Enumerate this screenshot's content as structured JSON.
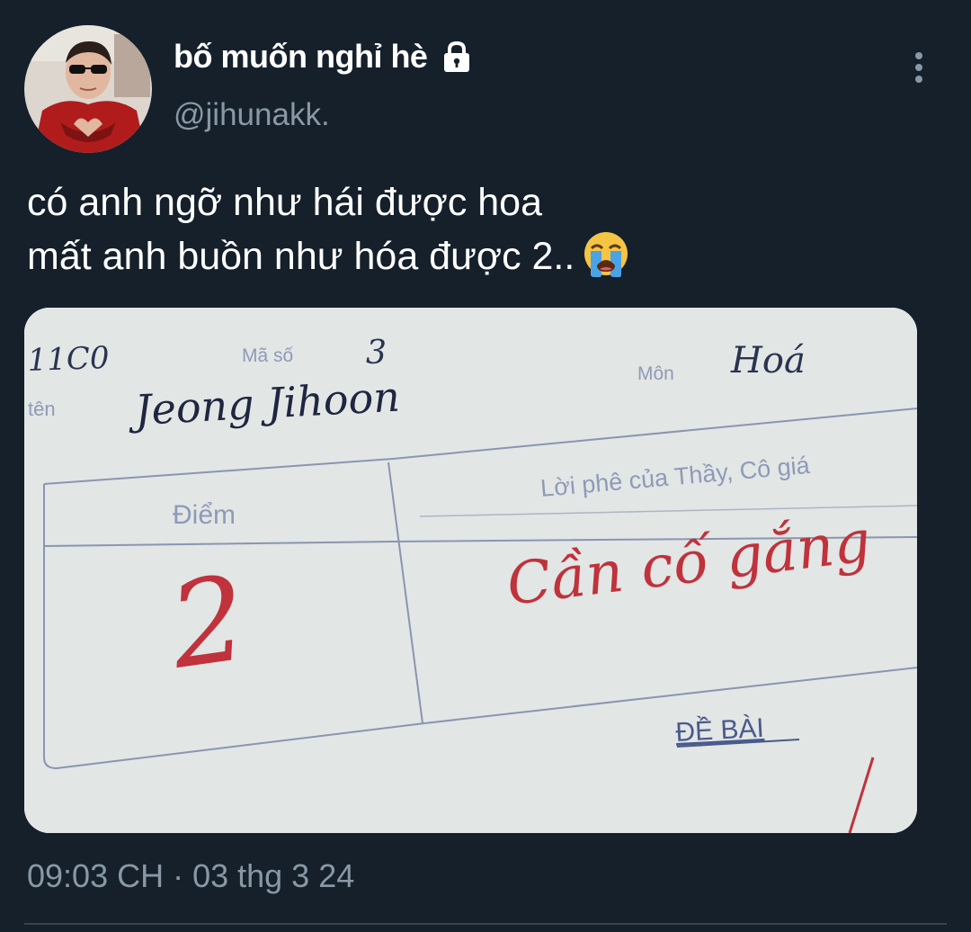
{
  "user": {
    "display_name": "bố muốn nghỉ hè",
    "handle": "@jihunakk.",
    "lock_icon": "lock-icon",
    "avatar_icon": "avatar"
  },
  "menu": {
    "more_icon": "more-vertical-icon"
  },
  "tweet": {
    "text_line_1": "có anh ngỡ như hái được hoa",
    "text_line_2": "mất anh buồn như hóa được 2..",
    "emoji": "loudly-crying-face-emoji"
  },
  "media": {
    "class_label": "11C0",
    "ma_so_label": "Mã số",
    "ma_so_value": "3",
    "mon_label": "Môn",
    "mon_value": "Hoá",
    "ten_label": "tên",
    "name_value": "Jeong Jihoon",
    "diem_label": "Điểm",
    "score_value": "2",
    "comment_label": "Lời phê của Thầy, Cô giá",
    "comment_value": "Cần cố gắng",
    "de_bai_label": "ĐỀ BÀI"
  },
  "meta": {
    "timestamp": "09:03 CH · 03 thg 3 24"
  },
  "colors": {
    "background": "#15202b",
    "secondary_text": "#8899a6",
    "red_ink": "#c0323c",
    "blue_ink": "#4a5a8c"
  }
}
